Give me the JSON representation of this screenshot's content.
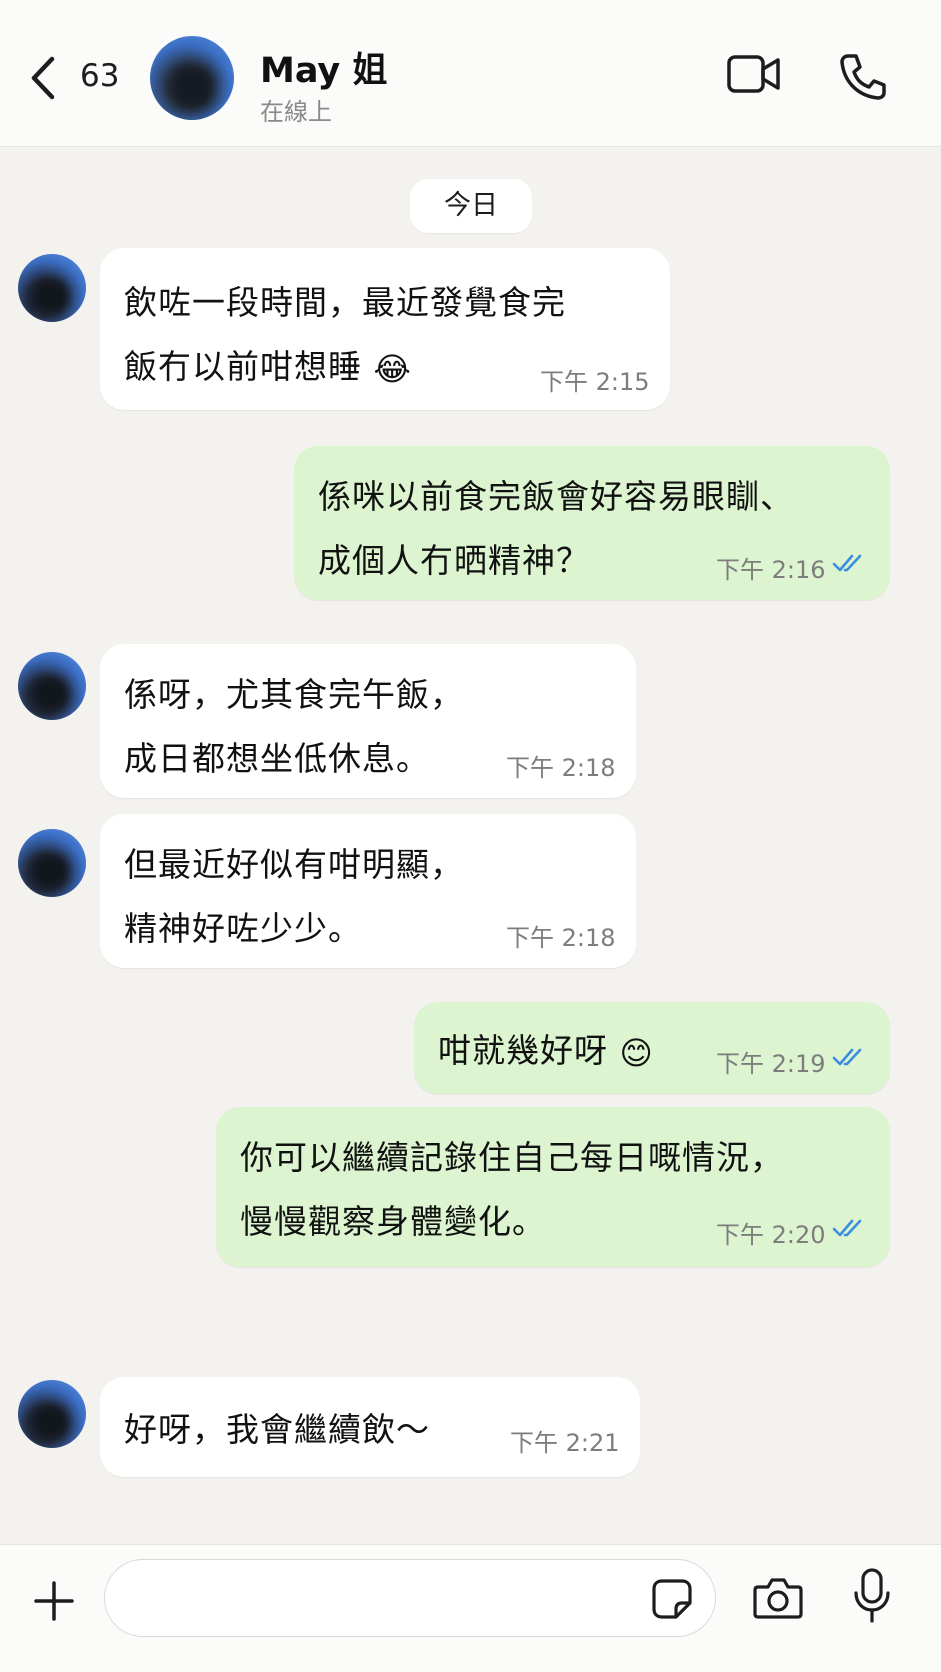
{
  "header": {
    "back_count": "63",
    "contact_name": "May 姐",
    "contact_status": "在線上"
  },
  "chat": {
    "date_label": "今日",
    "messages": [
      {
        "direction": "incoming",
        "lines": [
          "飲咗一段時間，最近發覺食完",
          "飯冇以前咁想睡"
        ],
        "emoji": "😂",
        "time": "下午 2:15"
      },
      {
        "direction": "outgoing",
        "lines": [
          "係咪以前食完飯會好容易眼瞓、",
          "成個人冇晒精神？"
        ],
        "time": "下午 2:16",
        "status": "read"
      },
      {
        "direction": "incoming",
        "lines": [
          "係呀，尤其食完午飯，",
          "成日都想坐低休息。"
        ],
        "time": "下午 2:18"
      },
      {
        "direction": "incoming",
        "lines": [
          "但最近好似有咁明顯，",
          "精神好咗少少。"
        ],
        "time": "下午 2:18"
      },
      {
        "direction": "outgoing",
        "lines": [
          "咁就幾好呀"
        ],
        "emoji": "😊",
        "time": "下午 2:19",
        "status": "read"
      },
      {
        "direction": "outgoing",
        "lines": [
          "你可以繼續記錄住自己每日嘅情況，",
          "慢慢觀察身體變化。"
        ],
        "time": "下午 2:20",
        "status": "read"
      },
      {
        "direction": "incoming",
        "lines": [
          "好呀，我會繼續飲～"
        ],
        "time": "下午 2:21"
      }
    ]
  },
  "composer": {
    "placeholder": ""
  },
  "colors": {
    "outgoing_bubble": "#dcf4cf",
    "incoming_bubble": "#ffffff",
    "read_ticks": "#3b8de0",
    "chat_background": "#f4f2ee"
  },
  "icons": [
    "chevron-left-icon",
    "video-camera-icon",
    "phone-icon",
    "plus-icon",
    "sticker-icon",
    "camera-icon",
    "microphone-icon",
    "double-check-icon"
  ]
}
